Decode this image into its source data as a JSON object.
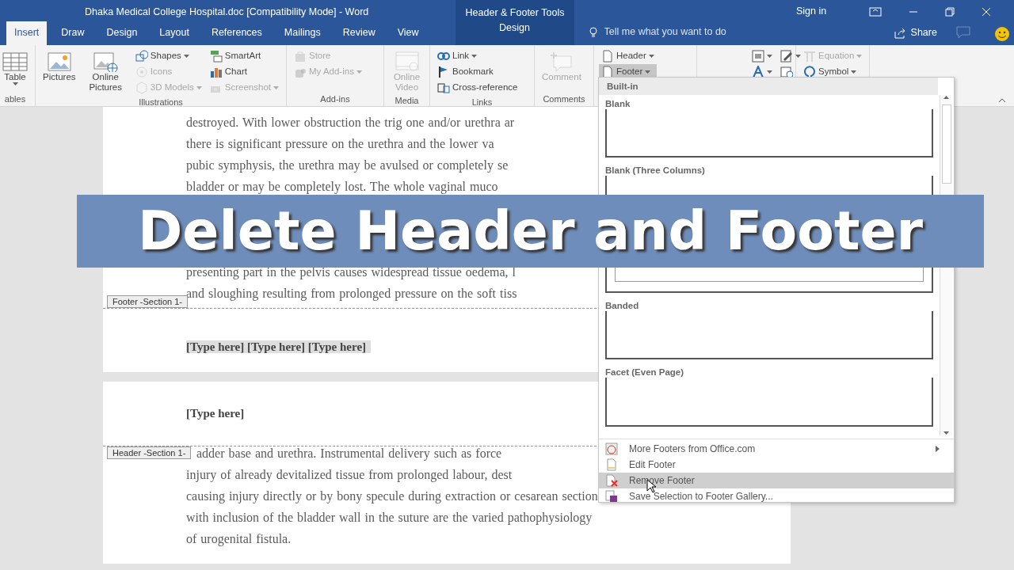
{
  "title_bar": {
    "title": "Dhaka Medical College Hospital.doc [Compatibility Mode]  -  Word",
    "context_label": "Header & Footer Tools",
    "sign_in": "Sign in"
  },
  "tabs": [
    {
      "label": "Insert",
      "selected": true,
      "kind": "standard"
    },
    {
      "label": "Draw",
      "selected": false,
      "kind": "standard"
    },
    {
      "label": "Design",
      "selected": false,
      "kind": "standard"
    },
    {
      "label": "Layout",
      "selected": false,
      "kind": "standard"
    },
    {
      "label": "References",
      "selected": false,
      "kind": "standard"
    },
    {
      "label": "Mailings",
      "selected": false,
      "kind": "standard"
    },
    {
      "label": "Review",
      "selected": false,
      "kind": "standard"
    },
    {
      "label": "View",
      "selected": false,
      "kind": "standard"
    },
    {
      "label": "Design",
      "selected": false,
      "kind": "contextual"
    }
  ],
  "tell_me": {
    "placeholder": "Tell me what you want to do"
  },
  "share": "Share",
  "ribbon_groups": [
    {
      "label": "ables",
      "items": [
        {
          "kind": "large",
          "label": "Table",
          "dropdown": true,
          "disabled": false,
          "pressed": false
        }
      ]
    },
    {
      "label": "Illustrations",
      "items": [
        {
          "kind": "large",
          "label": "Pictures",
          "dropdown": false,
          "disabled": false,
          "pressed": false
        },
        {
          "kind": "large",
          "label": "Online Pictures",
          "dropdown": false,
          "disabled": false,
          "pressed": false
        },
        {
          "kind": "small",
          "label": "Shapes",
          "dropdown": true,
          "disabled": false,
          "pressed": false
        },
        {
          "kind": "small",
          "label": "Icons",
          "dropdown": false,
          "disabled": true,
          "pressed": false
        },
        {
          "kind": "small",
          "label": "3D Models",
          "dropdown": true,
          "disabled": true,
          "pressed": false
        },
        {
          "kind": "small",
          "label": "SmartArt",
          "dropdown": false,
          "disabled": false,
          "pressed": false
        },
        {
          "kind": "small",
          "label": "Chart",
          "dropdown": false,
          "disabled": false,
          "pressed": false
        },
        {
          "kind": "small",
          "label": "Screenshot",
          "dropdown": true,
          "disabled": true,
          "pressed": false
        }
      ]
    },
    {
      "label": "Add-ins",
      "items": [
        {
          "kind": "small",
          "label": "Store",
          "dropdown": false,
          "disabled": true,
          "pressed": false
        },
        {
          "kind": "small",
          "label": "My Add-ins",
          "dropdown": true,
          "disabled": true,
          "pressed": false
        }
      ]
    },
    {
      "label": "Media",
      "items": [
        {
          "kind": "large",
          "label": "Online Video",
          "dropdown": false,
          "disabled": true,
          "pressed": false
        }
      ]
    },
    {
      "label": "Links",
      "items": [
        {
          "kind": "small",
          "label": "Link",
          "dropdown": true,
          "disabled": false,
          "pressed": false
        },
        {
          "kind": "small",
          "label": "Bookmark",
          "dropdown": false,
          "disabled": false,
          "pressed": false
        },
        {
          "kind": "small",
          "label": "Cross-reference",
          "dropdown": false,
          "disabled": false,
          "pressed": false
        }
      ]
    },
    {
      "label": "Comments",
      "items": [
        {
          "kind": "large",
          "label": "Comment",
          "dropdown": false,
          "disabled": true,
          "pressed": false
        }
      ]
    },
    {
      "items": [
        {
          "kind": "small",
          "label": "Header",
          "dropdown": true,
          "disabled": false,
          "pressed": false
        },
        {
          "kind": "small",
          "label": "Footer",
          "dropdown": true,
          "disabled": false,
          "pressed": true
        }
      ]
    },
    {
      "items": [
        {
          "kind": "icon",
          "dropdown": true,
          "disabled": false,
          "pressed": false
        },
        {
          "kind": "icon",
          "dropdown": true,
          "disabled": false,
          "pressed": false
        },
        {
          "kind": "icon",
          "dropdown": true,
          "disabled": false,
          "pressed": false
        },
        {
          "kind": "icon",
          "dropdown": false,
          "disabled": false,
          "pressed": false
        }
      ]
    },
    {
      "items": [
        {
          "kind": "small",
          "label": "Equation",
          "dropdown": true,
          "disabled": true,
          "pressed": false
        },
        {
          "kind": "small",
          "label": "Symbol",
          "dropdown": true,
          "disabled": false,
          "pressed": false
        }
      ]
    }
  ],
  "document": {
    "page1": {
      "lines_top": [
        "destroyed. With lower obstruction the trig one and/or urethra ar",
        "there is significant pressure on the urethra and the lower va",
        "pubic symphysis, the urethra may be avulsed or completely se",
        "bladder or may be completely lost. The whole vaginal muco"
      ],
      "lines_bottom": [
        "presenting part in the pelvis causes widespread tissue oedema, l",
        "and sloughing resulting from prolonged pressure on the soft tiss"
      ],
      "footer_tag": "Footer -Section 1-",
      "footer_text": "[Type here] [Type here] [Type here]"
    },
    "page2": {
      "header_text": "[Type here]",
      "header_tag": "Header -Section 1-",
      "lines": [
        "adder base and urethra. Instrumental delivery such as force",
        "injury of already devitalized tissue from prolonged labour, dest",
        "causing injury directly or by bony specule during extraction or cesarean section",
        "with inclusion of the bladder wall in the suture are the varied pathophysiology",
        "of urogenital fistula."
      ]
    }
  },
  "footer_menu": {
    "heading": "Built-in",
    "gallery": [
      {
        "label": "Blank",
        "kind": "single"
      },
      {
        "label": "Blank (Three Columns)",
        "kind": "framed"
      },
      {
        "label": "Banded",
        "kind": "single"
      },
      {
        "label": "Facet (Even Page)",
        "kind": "single"
      }
    ],
    "commands": [
      {
        "label": "More Footers from Office.com",
        "submenu": true,
        "selected": false
      },
      {
        "label": "Edit Footer",
        "submenu": false,
        "selected": false
      },
      {
        "label": "Remove Footer",
        "submenu": false,
        "selected": true
      },
      {
        "label": "Save Selection to Footer Gallery...",
        "submenu": false,
        "selected": false
      }
    ]
  },
  "banner": {
    "text": "Delete Header and Footer"
  }
}
